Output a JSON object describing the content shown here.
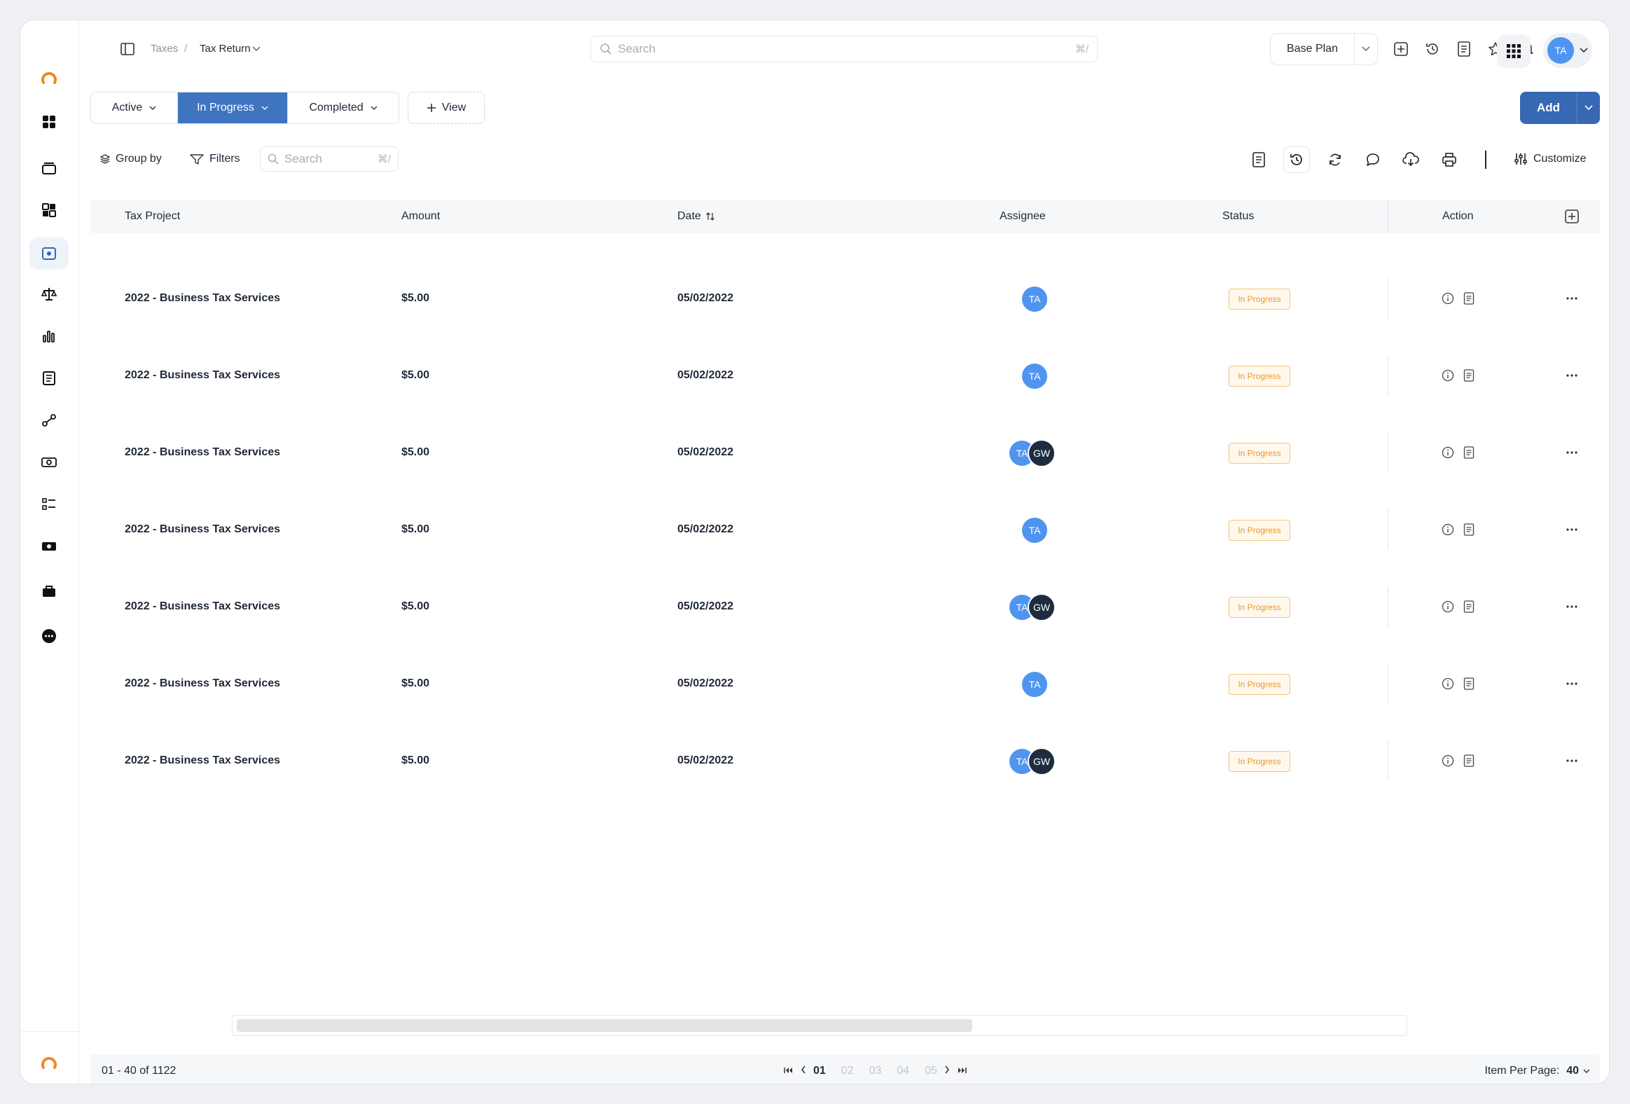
{
  "breadcrumb": {
    "parent": "Taxes",
    "separator": "/",
    "current": "Tax Return"
  },
  "top_search": {
    "placeholder": "Search",
    "shortcut": "⌘/"
  },
  "plan": {
    "label": "Base Plan"
  },
  "user": {
    "initials": "TA"
  },
  "view_tabs": [
    {
      "label": "Active",
      "active": false
    },
    {
      "label": "In Progress",
      "active": true
    },
    {
      "label": "Completed",
      "active": false
    }
  ],
  "view_button": "View",
  "add_button": "Add",
  "toolbar": {
    "group_by": "Group by",
    "filters": "Filters",
    "search_placeholder": "Search",
    "search_shortcut": "⌘/",
    "customize": "Customize"
  },
  "table": {
    "columns": [
      "Tax Project",
      "Amount",
      "Date",
      "Assignee",
      "Status",
      "Action"
    ],
    "rows": [
      {
        "project": "2022 - Business Tax Services",
        "amount": "$5.00",
        "date": "05/02/2022",
        "assignees": [
          "TA"
        ],
        "status": "In Progress"
      },
      {
        "project": "2022 - Business Tax Services",
        "amount": "$5.00",
        "date": "05/02/2022",
        "assignees": [
          "TA"
        ],
        "status": "In Progress"
      },
      {
        "project": "2022 - Business Tax Services",
        "amount": "$5.00",
        "date": "05/02/2022",
        "assignees": [
          "TA",
          "GW"
        ],
        "status": "In Progress"
      },
      {
        "project": "2022 - Business Tax Services",
        "amount": "$5.00",
        "date": "05/02/2022",
        "assignees": [
          "TA"
        ],
        "status": "In Progress"
      },
      {
        "project": "2022 - Business Tax Services",
        "amount": "$5.00",
        "date": "05/02/2022",
        "assignees": [
          "TA",
          "GW"
        ],
        "status": "In Progress"
      },
      {
        "project": "2022 - Business Tax Services",
        "amount": "$5.00",
        "date": "05/02/2022",
        "assignees": [
          "TA"
        ],
        "status": "In Progress"
      },
      {
        "project": "2022 - Business Tax Services",
        "amount": "$5.00",
        "date": "05/02/2022",
        "assignees": [
          "TA",
          "GW"
        ],
        "status": "In Progress"
      }
    ]
  },
  "pagination": {
    "range": "01 - 40 of 1122",
    "pages": [
      "01",
      "02",
      "03",
      "04",
      "05"
    ],
    "current_page": "01",
    "per_page_label": "Item Per Page:",
    "per_page_value": "40"
  },
  "colors": {
    "accent": "#3668b4",
    "tab_active": "#3f74c0",
    "avatar_ta": "#4f95f0",
    "avatar_gw": "#1f2c40",
    "status_border": "#f5c57a",
    "status_text": "#e89a2a",
    "logo": "#f08a1c"
  }
}
